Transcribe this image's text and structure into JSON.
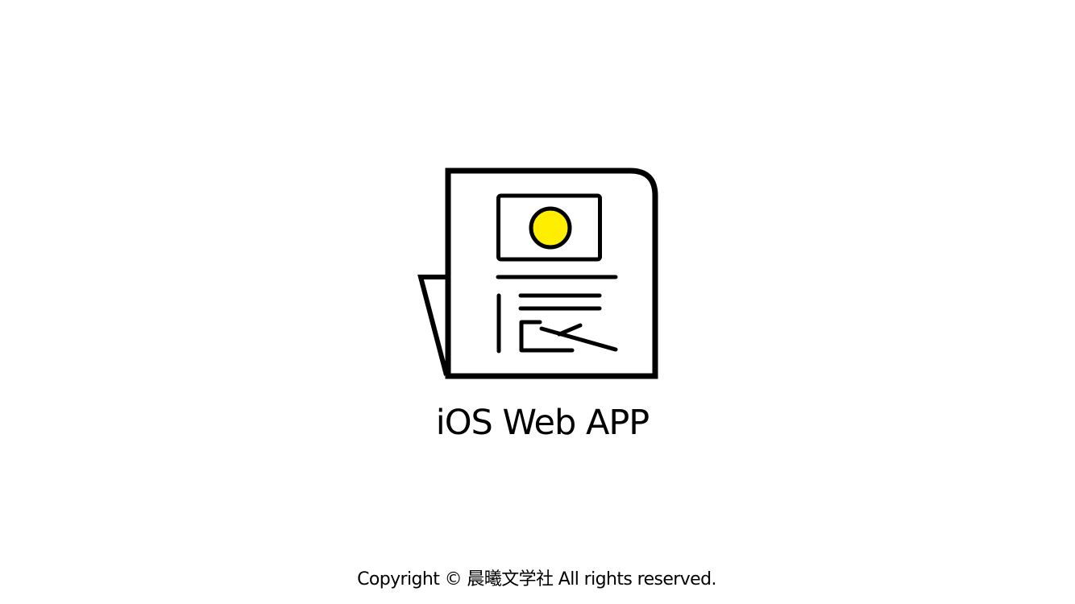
{
  "splash": {
    "logo_icon": "newspaper-sun-logo-icon",
    "app_title": "iOS Web APP",
    "copyright": "Copyright © 晨曦文学社 All rights reserved."
  },
  "colors": {
    "background": "#ffffff",
    "foreground": "#000000",
    "accent_sun": "#ffee00"
  }
}
